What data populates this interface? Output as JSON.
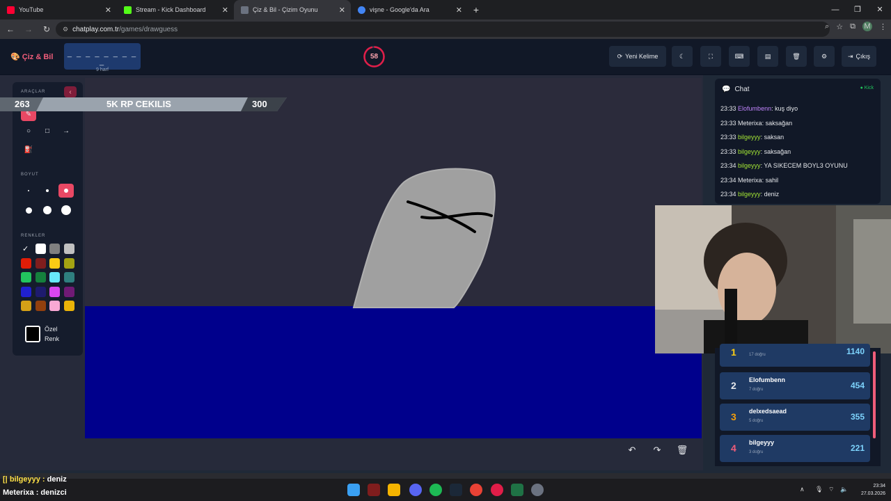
{
  "browser": {
    "tabs": [
      {
        "title": "YouTube",
        "color": "#ff0033"
      },
      {
        "title": "Stream - Kick Dashboard",
        "color": "#53fc18"
      },
      {
        "title": "Çiz & Bil - Çizim Oyunu",
        "color": "#6b7280"
      },
      {
        "title": "vişne - Google'da Ara",
        "color": "#4285f4"
      }
    ],
    "url_domain": "chatplay.com.tr",
    "url_path": "/games/drawguess",
    "profile_initial": "M"
  },
  "app": {
    "brand": "Çiz & Bil",
    "word_mask": "_ _ _ _ _ _ _ _ _",
    "word_hint": "9 harf",
    "timer": "58",
    "timer_fraction": 0.97,
    "buttons": {
      "new_word": "Yeni Kelime",
      "exit": "Çıkış"
    },
    "accent": "#f05d7a"
  },
  "tools": {
    "section_tools": "ARAÇLAR",
    "section_size": "BOYUT",
    "section_colors": "RENKLER",
    "custom_color_line1": "Özel",
    "custom_color_line2": "Renk",
    "palette": [
      "#ffffff",
      "#808080",
      "#c0c0c0",
      "#e11d07",
      "#7f1d1d",
      "#facc15",
      "#a3a312",
      "#22c55e",
      "#15803d",
      "#67e8f9",
      "#2f7f7f",
      "#2020d0",
      "#1e1b6e",
      "#d946ef",
      "#701a75",
      "#d4a017",
      "#92400e",
      "#f9a8d4",
      "#eab308"
    ]
  },
  "banner": {
    "left_number": "263",
    "title": "5K RP CEKILIS",
    "right_number": "300"
  },
  "chat": {
    "title": "Chat",
    "platform": "Kick",
    "messages": [
      {
        "time": "23:33",
        "user": "Elofumbenn",
        "text": "kuş diyo",
        "style": "u2"
      },
      {
        "time": "23:33",
        "user": "Meterixa",
        "text": "saksağan",
        "style": "u3"
      },
      {
        "time": "23:33",
        "user": "bilgeyyy",
        "text": "saksan",
        "style": "u"
      },
      {
        "time": "23:33",
        "user": "bilgeyyy",
        "text": "saksağan",
        "style": "u"
      },
      {
        "time": "23:34",
        "user": "bilgeyyy",
        "text": "YA SIKECEM BOYL3 OYUNU",
        "style": "u"
      },
      {
        "time": "23:34",
        "user": "Meterixa",
        "text": "sahil",
        "style": "u3"
      },
      {
        "time": "23:34",
        "user": "bilgeyyy",
        "text": "deniz",
        "style": "u"
      }
    ]
  },
  "leaderboard": [
    {
      "rank": "1",
      "name": "",
      "count": "17 doğru",
      "points": "1140",
      "color": "#facc15"
    },
    {
      "rank": "2",
      "name": "Elofumbenn",
      "count": "7 doğru",
      "points": "454",
      "color": "#e5e7eb"
    },
    {
      "rank": "3",
      "name": "delxedsaead",
      "count": "5 doğru",
      "points": "355",
      "color": "#f59e0b"
    },
    {
      "rank": "4",
      "name": "bilgeyyy",
      "count": "3 doğru",
      "points": "221",
      "color": "#f05d7a"
    }
  ],
  "overlay_chat": [
    {
      "user": "bilgeyyy",
      "text": "deniz"
    },
    {
      "user": "Meterixa",
      "text": "denizci"
    }
  ],
  "taskbar": {
    "time": "23:34",
    "date": "27.03.2026"
  }
}
